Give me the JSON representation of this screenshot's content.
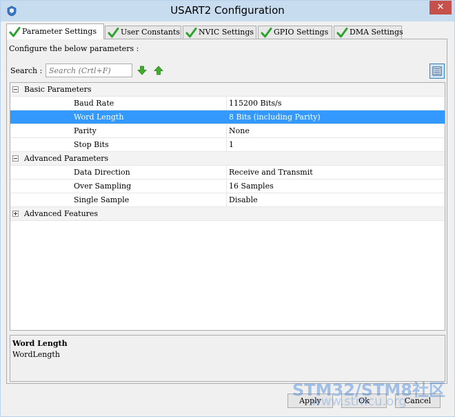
{
  "window": {
    "title": "USART2 Configuration",
    "close_glyph": "✕"
  },
  "tabs": [
    {
      "label": "Parameter Settings",
      "active": true,
      "icon": "checkmark-icon"
    },
    {
      "label": "User Constants",
      "active": false,
      "icon": "checkmark-icon"
    },
    {
      "label": "NVIC Settings",
      "active": false,
      "icon": "checkmark-icon"
    },
    {
      "label": "GPIO Settings",
      "active": false,
      "icon": "checkmark-icon"
    },
    {
      "label": "DMA Settings",
      "active": false,
      "icon": "checkmark-icon"
    }
  ],
  "configure_text": "Configure the below parameters :",
  "search": {
    "label": "Search :",
    "placeholder": "Search (Crtl+F)",
    "value": ""
  },
  "toolbar_icons": [
    "arrow-down-icon",
    "arrow-up-icon",
    "list-view-icon"
  ],
  "parameters": {
    "groups": [
      {
        "name": "Basic Parameters",
        "expanded": true,
        "items": [
          {
            "name": "Baud Rate",
            "value": "115200 Bits/s"
          },
          {
            "name": "Word Length",
            "value": "8 Bits (including Parity)",
            "selected": true
          },
          {
            "name": "Parity",
            "value": "None"
          },
          {
            "name": "Stop Bits",
            "value": "1"
          }
        ]
      },
      {
        "name": "Advanced Parameters",
        "expanded": true,
        "items": [
          {
            "name": "Data Direction",
            "value": "Receive and Transmit"
          },
          {
            "name": "Over Sampling",
            "value": "16 Samples"
          },
          {
            "name": "Single Sample",
            "value": "Disable"
          }
        ]
      },
      {
        "name": "Advanced Features",
        "expanded": false,
        "items": []
      }
    ]
  },
  "description": {
    "title": "Word Length",
    "text": "WordLength"
  },
  "buttons": {
    "apply": "Apply",
    "ok": "Ok",
    "cancel": "Cancel"
  },
  "watermark": {
    "line1": "STM32/STM8社区",
    "line2": "www.stmcu.org"
  },
  "colors": {
    "selection": "#3399ff",
    "titlebar": "#c8dcf0",
    "close_button": "#c7504b",
    "arrow_green": "#3fae2a"
  }
}
